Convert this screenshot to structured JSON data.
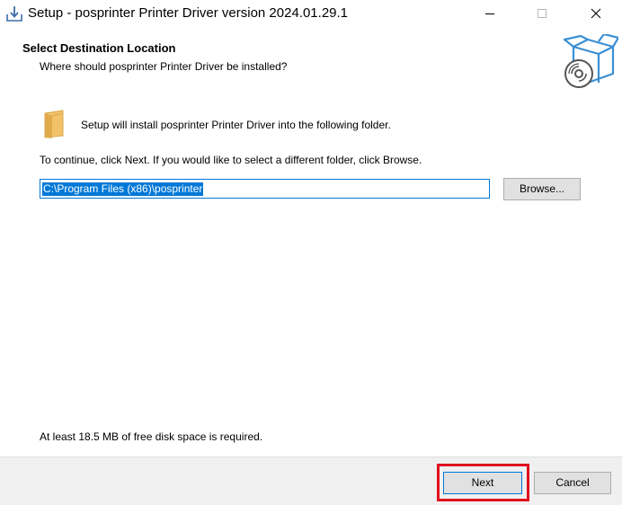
{
  "window": {
    "title": "Setup - posprinter Printer Driver version 2024.01.29.1",
    "controls": [
      "minimize-icon",
      "maximize-icon",
      "close-icon"
    ]
  },
  "header": {
    "title": "Select Destination Location",
    "subtitle": "Where should posprinter Printer Driver be installed?",
    "graphic_icon": "box-with-disc-icon"
  },
  "main": {
    "folder_icon": "folder-icon",
    "install_text": "Setup will install posprinter Printer Driver into the following folder.",
    "continue_text": "To continue, click Next. If you would like to select a different folder, click Browse.",
    "path_value": "C:\\Program Files (x86)\\posprinter",
    "browse_label": "Browse...",
    "diskspace_text": "At least 18.5 MB of free disk space is required."
  },
  "footer": {
    "next_label": "Next",
    "cancel_label": "Cancel"
  },
  "colors": {
    "accent": "#0078d7",
    "highlight": "#e0101e",
    "button_bg": "#e1e1e1",
    "footer_bg": "#f0f0f0"
  }
}
